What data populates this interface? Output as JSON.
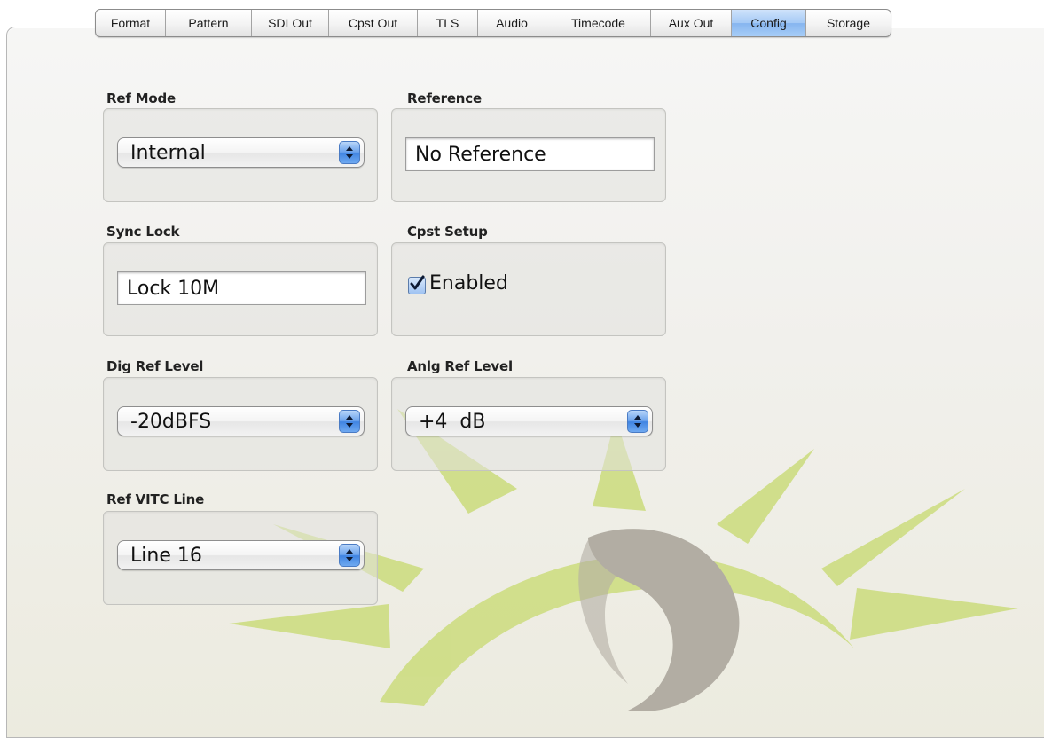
{
  "tabs": [
    {
      "label": "Format",
      "active": false
    },
    {
      "label": "Pattern",
      "active": false
    },
    {
      "label": "SDI Out",
      "active": false
    },
    {
      "label": "Cpst Out",
      "active": false
    },
    {
      "label": "TLS",
      "active": false
    },
    {
      "label": "Audio",
      "active": false
    },
    {
      "label": "Timecode",
      "active": false
    },
    {
      "label": "Aux Out",
      "active": false
    },
    {
      "label": "Config",
      "active": true
    },
    {
      "label": "Storage",
      "active": false
    }
  ],
  "ref_mode": {
    "label": "Ref Mode",
    "value": "Internal"
  },
  "reference": {
    "label": "Reference",
    "value": "No Reference"
  },
  "sync_lock": {
    "label": "Sync Lock",
    "value": "Lock 10M"
  },
  "cpst_setup": {
    "label": "Cpst Setup",
    "checkbox_label": "Enabled",
    "checked": true
  },
  "dig_ref_level": {
    "label": "Dig Ref Level",
    "value": "-20dBFS"
  },
  "anlg_ref_level": {
    "label": "Anlg Ref Level",
    "value": "+4  dB"
  },
  "ref_vitc_line": {
    "label": "Ref VITC Line",
    "value": "Line 16"
  },
  "colors": {
    "active_tab": "#a4c9f5",
    "accent_blue": "#3f84e2",
    "watermark_green": "#c9da7a",
    "watermark_gray": "#b0aca2"
  },
  "icons": [
    "up-down-arrows-icon",
    "checkmark-icon",
    "eye-logo-watermark"
  ]
}
